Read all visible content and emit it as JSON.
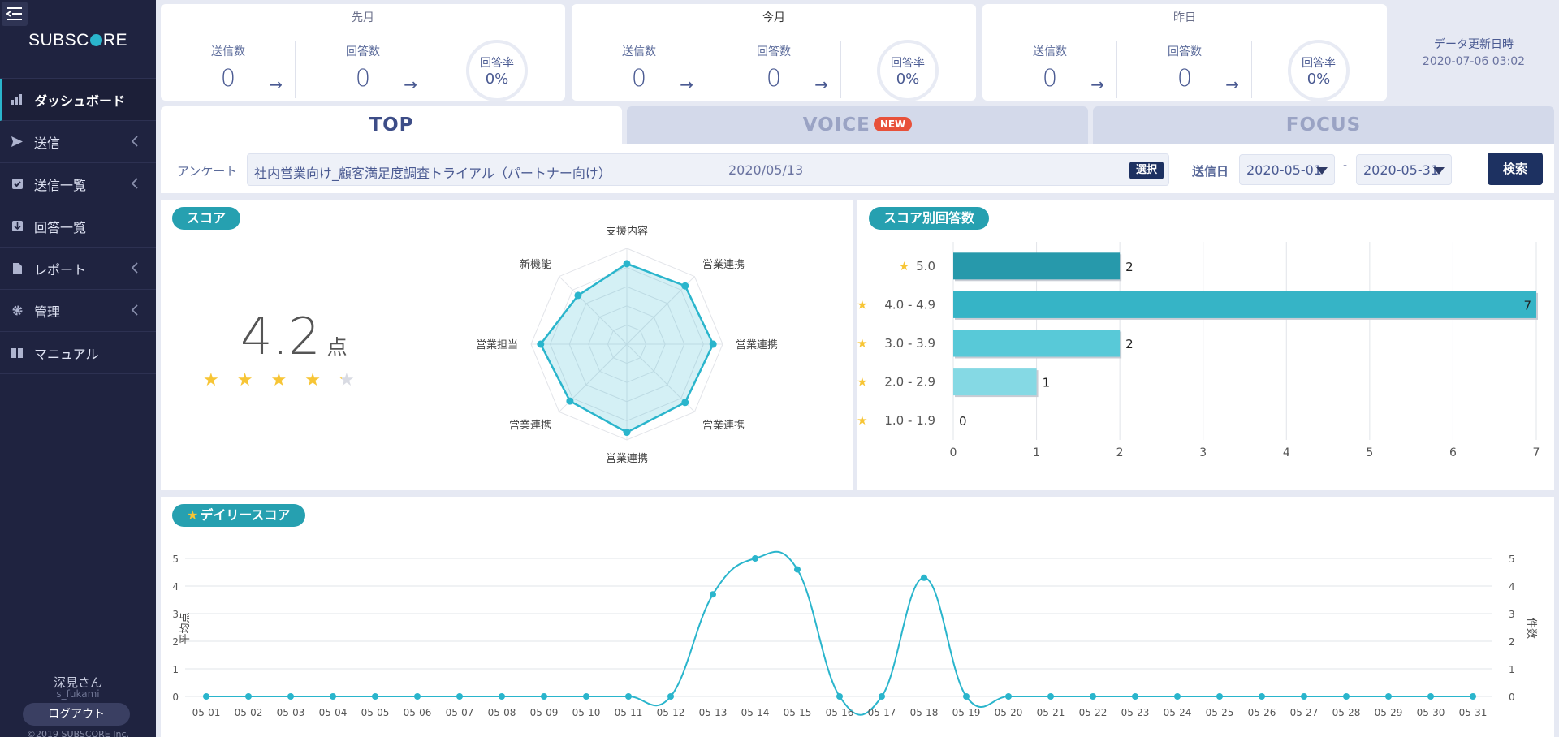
{
  "app": {
    "logo_prefix": "SUBSC",
    "logo_suffix": "RE",
    "user_name": "深見さん",
    "user_id": "s_fukami",
    "logout": "ログアウト",
    "copyright": "©2019 SUBSCORE Inc."
  },
  "sidebar": {
    "items": [
      {
        "label": "ダッシュボード"
      },
      {
        "label": "送信"
      },
      {
        "label": "送信一覧"
      },
      {
        "label": "回答一覧"
      },
      {
        "label": "レポート"
      },
      {
        "label": "管理"
      },
      {
        "label": "マニュアル"
      }
    ]
  },
  "summary": [
    {
      "title": "先月",
      "sent_label": "送信数",
      "sent": "0",
      "answered_label": "回答数",
      "answered": "0",
      "rate_label": "回答率",
      "rate": "0%"
    },
    {
      "title": "今月",
      "sent_label": "送信数",
      "sent": "0",
      "answered_label": "回答数",
      "answered": "0",
      "rate_label": "回答率",
      "rate": "0%"
    },
    {
      "title": "昨日",
      "sent_label": "送信数",
      "sent": "0",
      "answered_label": "回答数",
      "answered": "0",
      "rate_label": "回答率",
      "rate": "0%"
    }
  ],
  "update": {
    "label": "データ更新日時",
    "datetime": "2020-07-06 03:02"
  },
  "tabs": [
    {
      "label": "TOP"
    },
    {
      "label": "VOICE",
      "badge": "NEW"
    },
    {
      "label": "FOCUS"
    }
  ],
  "filter": {
    "survey_label": "アンケート",
    "survey_name": "社内営業向け_顧客満足度調査トライアル（パートナー向け）",
    "survey_date": "2020/05/13",
    "select_button": "選択",
    "date_label": "送信日",
    "date_from": "2020-05-01",
    "date_sep": "-",
    "date_to": "2020-05-31",
    "search_button": "検索"
  },
  "score_panel": {
    "title": "スコア",
    "score": "4.2",
    "unit": "点",
    "stars_rating": 4.2
  },
  "dist_panel": {
    "title": "スコア別回答数"
  },
  "daily_panel": {
    "title": "デイリースコア"
  },
  "colors": {
    "accent": "#26a0b0",
    "line": "#2ab5cc",
    "star": "#f7c535",
    "navy": "#1d3161"
  },
  "chart_data": [
    {
      "type": "radar",
      "axes": [
        "支援内容",
        "営業連携",
        "営業連携",
        "営業連携",
        "営業連携",
        "営業連携",
        "営業担当",
        "新機能"
      ],
      "values": [
        4.2,
        4.3,
        4.5,
        4.3,
        4.6,
        4.2,
        4.5,
        3.6
      ],
      "range": [
        0,
        5
      ]
    },
    {
      "type": "bar",
      "orientation": "horizontal",
      "categories": [
        "5.0",
        "4.0 - 4.9",
        "3.0 - 3.9",
        "2.0 - 2.9",
        "1.0 - 1.9"
      ],
      "values": [
        2,
        7,
        2,
        1,
        0
      ],
      "colors": [
        "#2799ab",
        "#36b4c6",
        "#58c9d8",
        "#85d9e4",
        "#a8e4ec"
      ],
      "xlim": [
        0,
        7
      ],
      "xticks": [
        0,
        1,
        2,
        3,
        4,
        5,
        6,
        7
      ],
      "grid": true
    },
    {
      "type": "line",
      "x": [
        "05-01",
        "05-02",
        "05-03",
        "05-04",
        "05-05",
        "05-06",
        "05-07",
        "05-08",
        "05-09",
        "05-10",
        "05-11",
        "05-12",
        "05-13",
        "05-14",
        "05-15",
        "05-16",
        "05-17",
        "05-18",
        "05-19",
        "05-20",
        "05-21",
        "05-22",
        "05-23",
        "05-24",
        "05-25",
        "05-26",
        "05-27",
        "05-28",
        "05-29",
        "05-30",
        "05-31"
      ],
      "y": [
        0,
        0,
        0,
        0,
        0,
        0,
        0,
        0,
        0,
        0,
        0,
        0,
        3.7,
        5.0,
        4.6,
        0,
        0,
        4.3,
        0,
        0,
        0,
        0,
        0,
        0,
        0,
        0,
        0,
        0,
        0,
        0,
        0
      ],
      "ylabel": "平均点",
      "y2label": "件数",
      "ylim": [
        0,
        5
      ],
      "yticks": [
        0,
        1,
        2,
        3,
        4,
        5
      ],
      "grid": true
    }
  ]
}
